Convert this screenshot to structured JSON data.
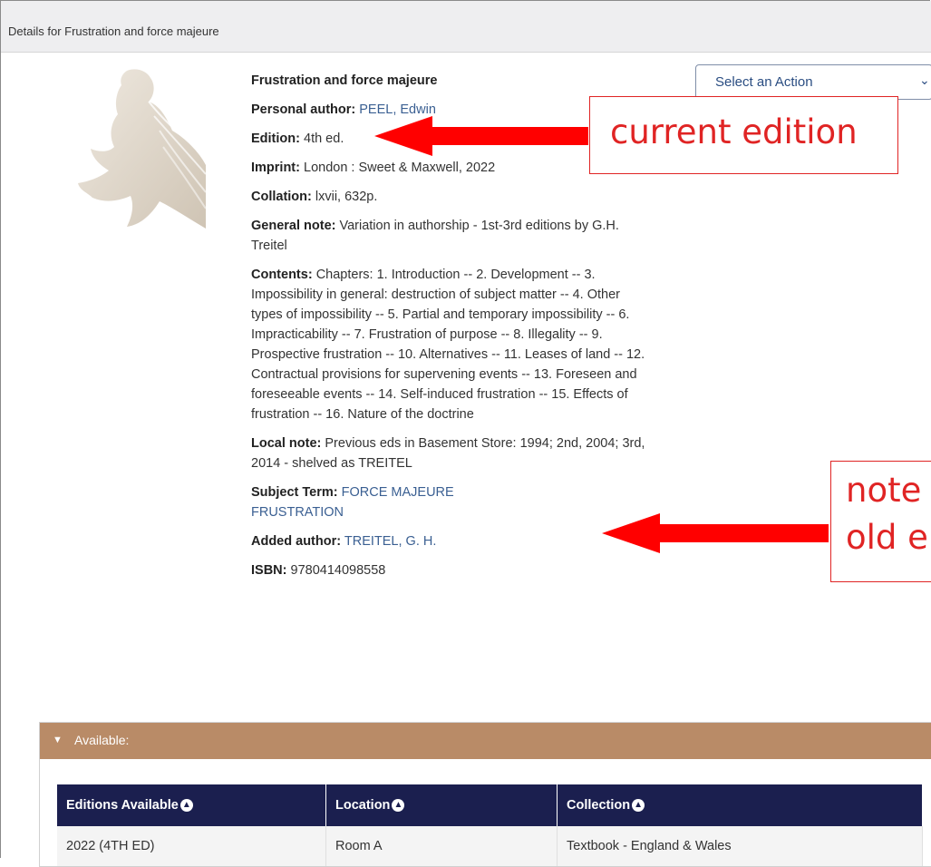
{
  "header": {
    "title": "Details for Frustration and force majeure"
  },
  "action_select": {
    "label": "Select an Action"
  },
  "record": {
    "title": "Frustration and force majeure",
    "personal_author_label": "Personal author:",
    "personal_author": "PEEL, Edwin",
    "edition_label": "Edition:",
    "edition": "4th ed.",
    "imprint_label": "Imprint:",
    "imprint": "London : Sweet & Maxwell, 2022",
    "collation_label": "Collation:",
    "collation": "lxvii, 632p.",
    "general_note_label": "General note:",
    "general_note": "Variation in authorship - 1st-3rd editions by G.H. Treitel",
    "contents_label": "Contents:",
    "contents": "Chapters: 1. Introduction -- 2. Development -- 3. Impossibility in general: destruction of subject matter -- 4. Other types of impossibility -- 5. Partial and temporary impossibility -- 6. Impracticability -- 7. Frustration of purpose -- 8. Illegality -- 9. Prospective frustration -- 10. Alternatives -- 11. Leases of land -- 12. Contractual provisions for supervening events -- 13. Foreseen and foreseeable events -- 14. Self-induced frustration -- 15. Effects of frustration -- 16. Nature of the doctrine",
    "local_note_label": "Local note:",
    "local_note": "Previous eds in Basement Store: 1994; 2nd, 2004; 3rd, 2014 - shelved as TREITEL",
    "subject_term_label": "Subject Term:",
    "subject_terms": [
      "FORCE MAJEURE",
      "FRUSTRATION"
    ],
    "added_author_label": "Added author:",
    "added_author": "TREITEL, G. H.",
    "isbn_label": "ISBN:",
    "isbn": "9780414098558"
  },
  "annotations": {
    "current_edition": "current edition",
    "note_line1": "note",
    "note_line2": "old e"
  },
  "availability": {
    "label": "Available:",
    "columns": [
      "Editions Available",
      "Location",
      "Collection"
    ],
    "rows": [
      [
        "2022 (4TH ED)",
        "Room A",
        "Textbook - England & Wales"
      ]
    ]
  },
  "colors": {
    "accent_link": "#3a5f92",
    "annotation_red": "#e02424",
    "availability_bar": "#b98b67",
    "table_header": "#1b1f4f"
  }
}
